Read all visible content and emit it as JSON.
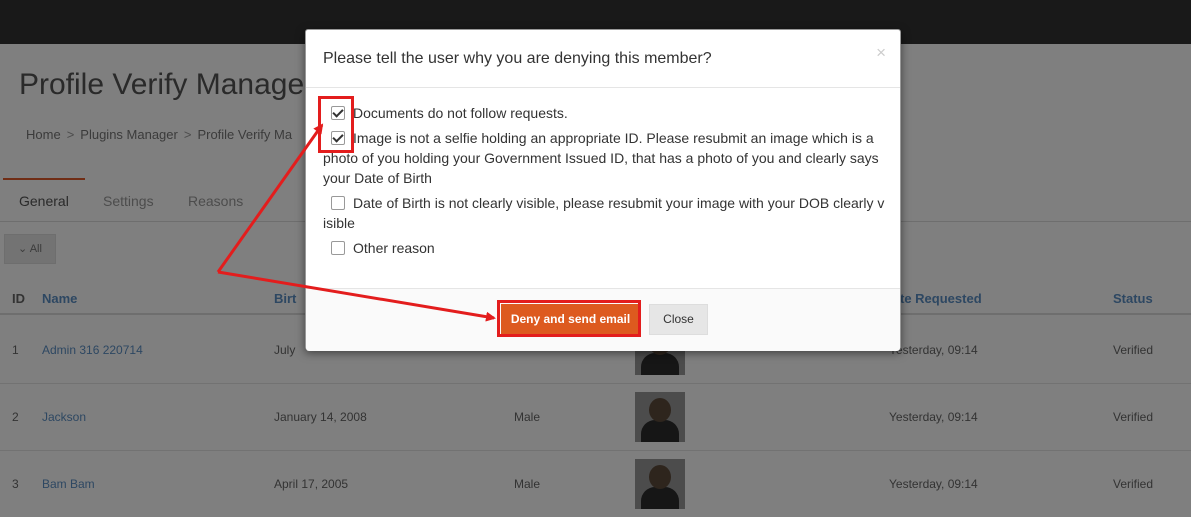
{
  "page": {
    "title": "Profile Verify Manager",
    "breadcrumb": [
      "Home",
      "Plugins Manager",
      "Profile Verify Ma"
    ],
    "breadcrumb_separator": ">",
    "tabs": [
      "General",
      "Settings",
      "Reasons"
    ],
    "filter_label": "All"
  },
  "table": {
    "headers": [
      "ID",
      "Name",
      "Birt",
      "te Requested",
      "Status"
    ],
    "rows": [
      {
        "id": "1",
        "name": "Admin 316 220714",
        "birthday": "July",
        "gender": "",
        "requested": "Yesterday, 09:14",
        "status": "Verified"
      },
      {
        "id": "2",
        "name": "Jackson",
        "birthday": "January 14, 2008",
        "gender": "Male",
        "requested": "Yesterday, 09:14",
        "status": "Verified"
      },
      {
        "id": "3",
        "name": "Bam Bam",
        "birthday": "April 17, 2005",
        "gender": "Male",
        "requested": "Yesterday, 09:14",
        "status": "Verified"
      }
    ]
  },
  "modal": {
    "title": "Please tell the user why you are denying this member?",
    "close_x": "×",
    "reasons": [
      {
        "text": "Documents do not follow requests.",
        "checked": true
      },
      {
        "text": "Image is not a selfie holding an appropriate ID. Please resubmit an image which is a photo of you holding your Government Issued ID, that has a photo of you and clearly says your Date of Birth",
        "checked": true
      },
      {
        "text": "Date of Birth is not clearly visible, please resubmit your image with your DOB clearly v isible",
        "checked": false
      },
      {
        "text": "Other reason",
        "checked": false
      }
    ],
    "deny_button": "Deny and send email",
    "close_button": "Close"
  },
  "colors": {
    "accent": "#dd5a1f",
    "annotation": "#e31d1d",
    "link": "#5b8fc4"
  },
  "icons": {
    "close_x": "close-icon",
    "filter": "chevron-down-icon",
    "checkbox_checked": "checkmark-icon"
  }
}
